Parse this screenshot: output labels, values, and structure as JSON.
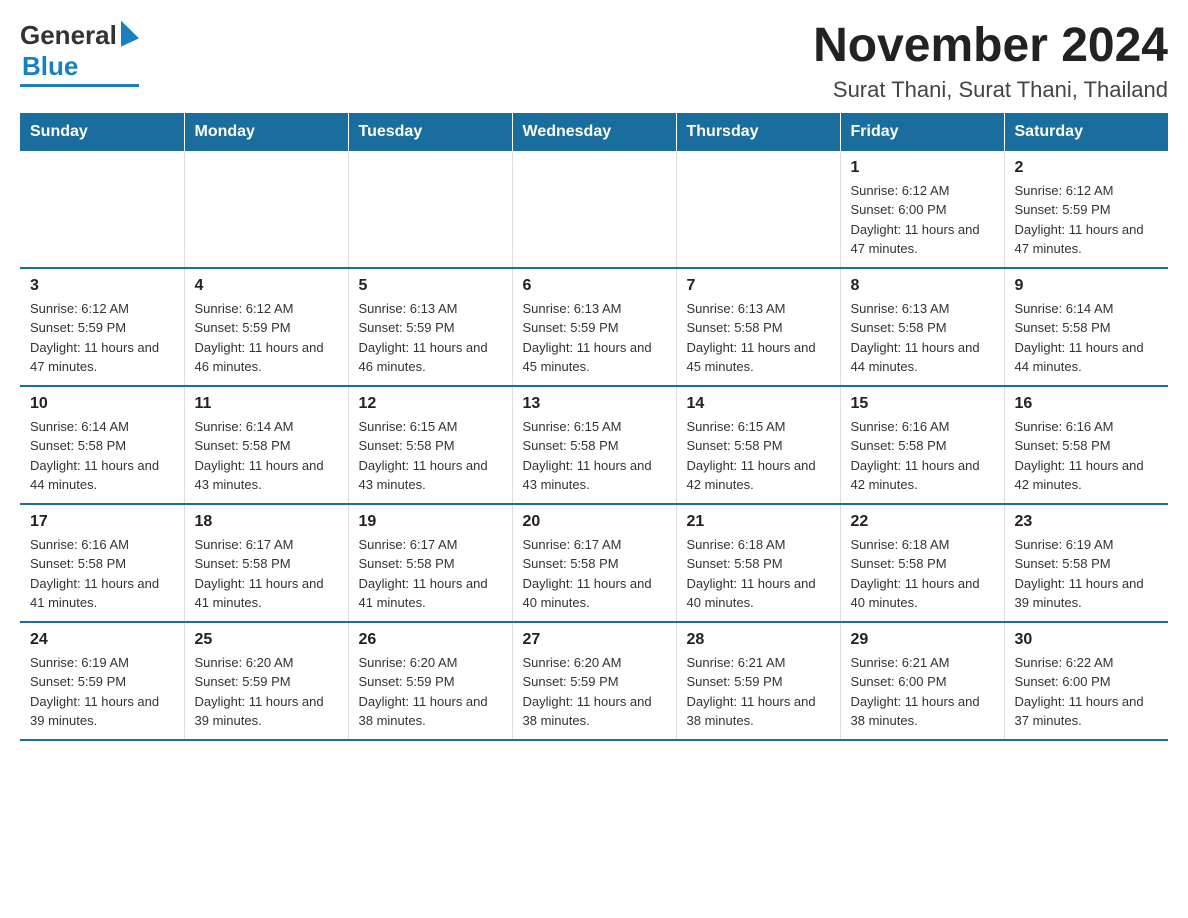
{
  "logo": {
    "general": "General",
    "blue": "Blue"
  },
  "title": "November 2024",
  "subtitle": "Surat Thani, Surat Thani, Thailand",
  "headers": [
    "Sunday",
    "Monday",
    "Tuesday",
    "Wednesday",
    "Thursday",
    "Friday",
    "Saturday"
  ],
  "weeks": [
    [
      {
        "day": "",
        "info": ""
      },
      {
        "day": "",
        "info": ""
      },
      {
        "day": "",
        "info": ""
      },
      {
        "day": "",
        "info": ""
      },
      {
        "day": "",
        "info": ""
      },
      {
        "day": "1",
        "info": "Sunrise: 6:12 AM\nSunset: 6:00 PM\nDaylight: 11 hours\nand 47 minutes."
      },
      {
        "day": "2",
        "info": "Sunrise: 6:12 AM\nSunset: 5:59 PM\nDaylight: 11 hours\nand 47 minutes."
      }
    ],
    [
      {
        "day": "3",
        "info": "Sunrise: 6:12 AM\nSunset: 5:59 PM\nDaylight: 11 hours\nand 47 minutes."
      },
      {
        "day": "4",
        "info": "Sunrise: 6:12 AM\nSunset: 5:59 PM\nDaylight: 11 hours\nand 46 minutes."
      },
      {
        "day": "5",
        "info": "Sunrise: 6:13 AM\nSunset: 5:59 PM\nDaylight: 11 hours\nand 46 minutes."
      },
      {
        "day": "6",
        "info": "Sunrise: 6:13 AM\nSunset: 5:59 PM\nDaylight: 11 hours\nand 45 minutes."
      },
      {
        "day": "7",
        "info": "Sunrise: 6:13 AM\nSunset: 5:58 PM\nDaylight: 11 hours\nand 45 minutes."
      },
      {
        "day": "8",
        "info": "Sunrise: 6:13 AM\nSunset: 5:58 PM\nDaylight: 11 hours\nand 44 minutes."
      },
      {
        "day": "9",
        "info": "Sunrise: 6:14 AM\nSunset: 5:58 PM\nDaylight: 11 hours\nand 44 minutes."
      }
    ],
    [
      {
        "day": "10",
        "info": "Sunrise: 6:14 AM\nSunset: 5:58 PM\nDaylight: 11 hours\nand 44 minutes."
      },
      {
        "day": "11",
        "info": "Sunrise: 6:14 AM\nSunset: 5:58 PM\nDaylight: 11 hours\nand 43 minutes."
      },
      {
        "day": "12",
        "info": "Sunrise: 6:15 AM\nSunset: 5:58 PM\nDaylight: 11 hours\nand 43 minutes."
      },
      {
        "day": "13",
        "info": "Sunrise: 6:15 AM\nSunset: 5:58 PM\nDaylight: 11 hours\nand 43 minutes."
      },
      {
        "day": "14",
        "info": "Sunrise: 6:15 AM\nSunset: 5:58 PM\nDaylight: 11 hours\nand 42 minutes."
      },
      {
        "day": "15",
        "info": "Sunrise: 6:16 AM\nSunset: 5:58 PM\nDaylight: 11 hours\nand 42 minutes."
      },
      {
        "day": "16",
        "info": "Sunrise: 6:16 AM\nSunset: 5:58 PM\nDaylight: 11 hours\nand 42 minutes."
      }
    ],
    [
      {
        "day": "17",
        "info": "Sunrise: 6:16 AM\nSunset: 5:58 PM\nDaylight: 11 hours\nand 41 minutes."
      },
      {
        "day": "18",
        "info": "Sunrise: 6:17 AM\nSunset: 5:58 PM\nDaylight: 11 hours\nand 41 minutes."
      },
      {
        "day": "19",
        "info": "Sunrise: 6:17 AM\nSunset: 5:58 PM\nDaylight: 11 hours\nand 41 minutes."
      },
      {
        "day": "20",
        "info": "Sunrise: 6:17 AM\nSunset: 5:58 PM\nDaylight: 11 hours\nand 40 minutes."
      },
      {
        "day": "21",
        "info": "Sunrise: 6:18 AM\nSunset: 5:58 PM\nDaylight: 11 hours\nand 40 minutes."
      },
      {
        "day": "22",
        "info": "Sunrise: 6:18 AM\nSunset: 5:58 PM\nDaylight: 11 hours\nand 40 minutes."
      },
      {
        "day": "23",
        "info": "Sunrise: 6:19 AM\nSunset: 5:58 PM\nDaylight: 11 hours\nand 39 minutes."
      }
    ],
    [
      {
        "day": "24",
        "info": "Sunrise: 6:19 AM\nSunset: 5:59 PM\nDaylight: 11 hours\nand 39 minutes."
      },
      {
        "day": "25",
        "info": "Sunrise: 6:20 AM\nSunset: 5:59 PM\nDaylight: 11 hours\nand 39 minutes."
      },
      {
        "day": "26",
        "info": "Sunrise: 6:20 AM\nSunset: 5:59 PM\nDaylight: 11 hours\nand 38 minutes."
      },
      {
        "day": "27",
        "info": "Sunrise: 6:20 AM\nSunset: 5:59 PM\nDaylight: 11 hours\nand 38 minutes."
      },
      {
        "day": "28",
        "info": "Sunrise: 6:21 AM\nSunset: 5:59 PM\nDaylight: 11 hours\nand 38 minutes."
      },
      {
        "day": "29",
        "info": "Sunrise: 6:21 AM\nSunset: 6:00 PM\nDaylight: 11 hours\nand 38 minutes."
      },
      {
        "day": "30",
        "info": "Sunrise: 6:22 AM\nSunset: 6:00 PM\nDaylight: 11 hours\nand 37 minutes."
      }
    ]
  ]
}
